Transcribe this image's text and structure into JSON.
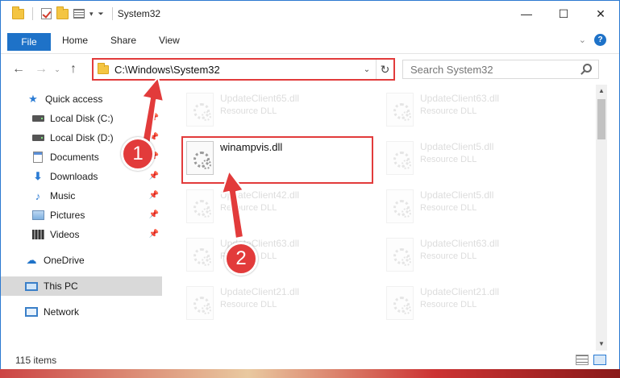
{
  "window": {
    "title": "System32",
    "controls": {
      "minimize": "—",
      "maximize": "☐",
      "close": "✕"
    }
  },
  "ribbon": {
    "tabs": [
      "File",
      "Home",
      "Share",
      "View"
    ],
    "help": "?"
  },
  "nav": {
    "address": "C:\\Windows\\System32",
    "search_placeholder": "Search System32"
  },
  "sidebar": {
    "items": [
      {
        "label": "Quick access",
        "icon": "star-icon"
      },
      {
        "label": "Local Disk (C:)",
        "icon": "disk-icon",
        "pinned": true
      },
      {
        "label": "Local Disk (D:)",
        "icon": "disk-icon",
        "pinned": true
      },
      {
        "label": "Documents",
        "icon": "documents-icon",
        "pinned": true
      },
      {
        "label": "Downloads",
        "icon": "downloads-icon",
        "pinned": true
      },
      {
        "label": "Music",
        "icon": "music-icon",
        "pinned": true
      },
      {
        "label": "Pictures",
        "icon": "pictures-icon",
        "pinned": true
      },
      {
        "label": "Videos",
        "icon": "videos-icon",
        "pinned": true
      },
      {
        "label": "OneDrive",
        "icon": "onedrive-icon"
      },
      {
        "label": "This PC",
        "icon": "pc-icon",
        "selected": true
      },
      {
        "label": "Network",
        "icon": "network-icon"
      }
    ]
  },
  "files": [
    {
      "name": "UpdateClient65.dll",
      "type": "Resource DLL"
    },
    {
      "name": "UpdateClient63.dll",
      "type": "Resource DLL"
    },
    {
      "name": "winampvis.dll",
      "type": ""
    },
    {
      "name": "UpdateClient5.dll",
      "type": "Resource DLL"
    },
    {
      "name": "UpdateClient42.dll",
      "type": "Resource DLL"
    },
    {
      "name": "UpdateClient5.dll",
      "type": "Resource DLL"
    },
    {
      "name": "UpdateClient63.dll",
      "type": "Resource DLL"
    },
    {
      "name": "UpdateClient63.dll",
      "type": "Resource DLL"
    },
    {
      "name": "UpdateClient21.dll",
      "type": "Resource DLL"
    },
    {
      "name": "UpdateClient21.dll",
      "type": "Resource DLL"
    }
  ],
  "status": {
    "item_count": "115 items"
  },
  "annotations": {
    "step1": "1",
    "step2": "2",
    "color": "#e23b3b"
  }
}
